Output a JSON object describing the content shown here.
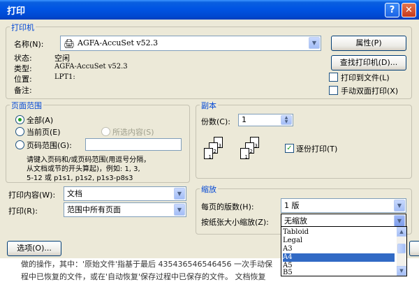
{
  "dialog": {
    "title": "打印",
    "help_glyph": "?",
    "close_glyph": "✕"
  },
  "printer": {
    "group": "打印机",
    "name_label": "名称(N):",
    "name_value": "AGFA-AccuSet v52.3",
    "status_label": "状态:",
    "status_value": "空闲",
    "type_label": "类型:",
    "type_value": "AGFA-AccuSet v52.3",
    "where_label": "位置:",
    "where_value": "LPT1:",
    "comment_label": "备注:",
    "properties": "属性(P)",
    "find": "查找打印机(D)...",
    "print_to_file": "打印到文件(L)",
    "manual_duplex": "手动双面打印(X)"
  },
  "range": {
    "group": "页面范围",
    "all": "全部(A)",
    "current": "当前页(E)",
    "selection": "所选内容(S)",
    "pages": "页码范围(G):",
    "hint1": "请键入页码和/或页码范围(用逗号分隔，",
    "hint2": "从文档或节的开头算起)，例如: 1, 3,",
    "hint3": "5-12 或 p1s1, p1s2, p1s3-p8s3"
  },
  "copies": {
    "group": "副本",
    "count_label": "份数(C):",
    "count_value": "1",
    "collate": "逐份打印(T)",
    "page_labels": [
      "1",
      "2",
      "3"
    ]
  },
  "printwhat": {
    "label": "打印内容(W):",
    "value": "文档",
    "print_label": "打印(R):",
    "print_value": "范围中所有页面"
  },
  "zoom": {
    "group": "缩放",
    "pps_label": "每页的版数(H):",
    "pps_value": "1 版",
    "scale_label": "按纸张大小缩放(Z):",
    "scale_value": "无缩放",
    "options": [
      "Tabloid",
      "Legal",
      "A3",
      "A4",
      "A5",
      "B5"
    ],
    "selected": "A4"
  },
  "options_button": "选项(O)...",
  "background": {
    "line1": "做的操作，其中：'原始文件'指基于最后 435436546546456 一次手动保",
    "line2": "程中已恢复的文件，或在'自动恢复'保存过程中已保存的文件。   文档恢复"
  },
  "colors": {
    "title_blue": "#0054e3",
    "legend_blue": "#0046d5",
    "dialog_face": "#ece9d8",
    "selection_blue": "#316ac5"
  }
}
